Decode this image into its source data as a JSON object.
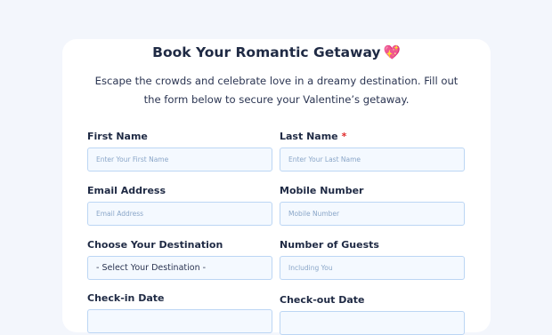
{
  "form": {
    "title": "Book Your Romantic Getaway",
    "title_emoji": "💖",
    "description": "Escape the crowds and celebrate love in a dreamy destination. Fill out the form below to secure your Valentine’s getaway.",
    "required_marker": "*",
    "fields": {
      "first_name": {
        "label": "First Name",
        "placeholder": "Enter Your First Name"
      },
      "last_name": {
        "label": "Last Name",
        "placeholder": "Enter Your Last Name",
        "required": true
      },
      "email": {
        "label": "Email Address",
        "placeholder": "Email Address"
      },
      "mobile": {
        "label": "Mobile Number",
        "placeholder": "Mobile Number"
      },
      "destination": {
        "label": "Choose Your Destination",
        "selected": "- Select Your Destination -"
      },
      "guests": {
        "label": "Number of Guests",
        "placeholder": "Including You"
      },
      "checkin": {
        "label": "Check-in Date"
      },
      "checkout": {
        "label": "Check-out Date"
      }
    }
  },
  "colors": {
    "background": "#f3f6fc",
    "field_border": "#bcd6f4",
    "field_bg": "#f4f9ff",
    "required": "#e02b2b"
  }
}
